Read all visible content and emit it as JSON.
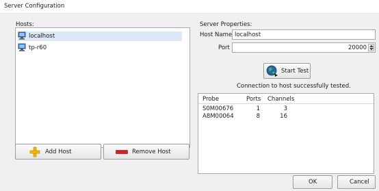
{
  "window": {
    "title": "Server Configuration"
  },
  "hosts_panel": {
    "label": "Hosts:",
    "hosts": [
      {
        "name": "localhost",
        "selected": true
      },
      {
        "name": "tp-r60",
        "selected": false
      }
    ],
    "add_button": "Add Host",
    "remove_button": "Remove Host"
  },
  "properties": {
    "label": "Server Properties:",
    "host_name_label": "Host Name",
    "host_name_value": "localhost",
    "port_label": "Port",
    "port_value": "20000",
    "start_test_button": "Start Test",
    "status_text": "Connection to host successfully tested."
  },
  "probe_table": {
    "columns": [
      "Probe",
      "Ports",
      "Channels"
    ],
    "rows": [
      {
        "probe": "S0M00676",
        "ports": "1",
        "channels": "3"
      },
      {
        "probe": "A8M00064",
        "ports": "8",
        "channels": "16"
      }
    ]
  },
  "footer": {
    "ok_button": "OK",
    "cancel_button": "Cancel"
  },
  "colors": {
    "add_icon": "#f2b600",
    "remove_icon": "#d32020",
    "globe": "#1e6ba8"
  }
}
